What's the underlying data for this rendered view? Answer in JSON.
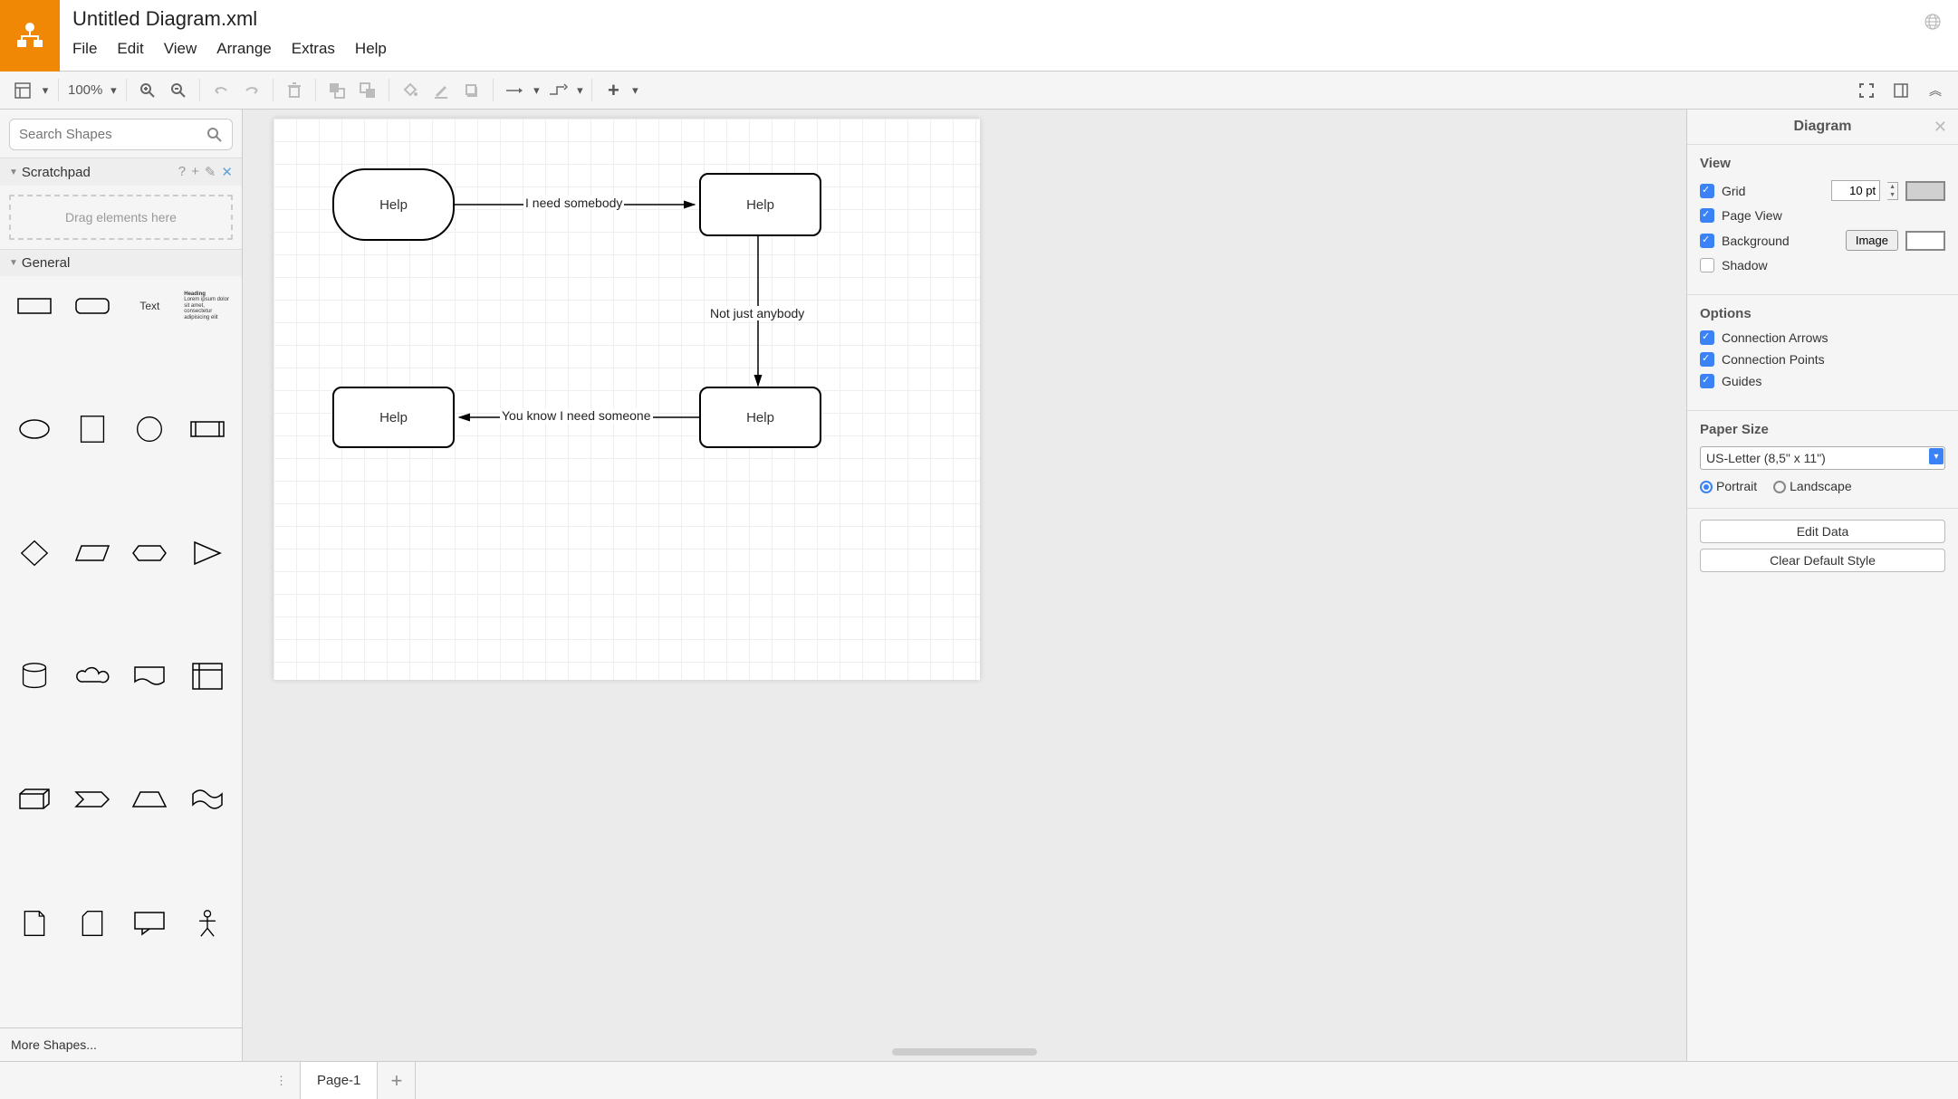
{
  "title": "Untitled Diagram.xml",
  "menu": {
    "file": "File",
    "edit": "Edit",
    "view": "View",
    "arrange": "Arrange",
    "extras": "Extras",
    "help": "Help"
  },
  "toolbar": {
    "zoom": "100%"
  },
  "sidebar": {
    "search_placeholder": "Search Shapes",
    "scratchpad": "Scratchpad",
    "scratchpad_hint": "Drag elements here",
    "general": "General",
    "more_shapes": "More Shapes...",
    "text_shape": "Text",
    "heading_shape_title": "Heading",
    "heading_shape_body": "Lorem ipsum dolor sit amet, consectetur adipisicing elit"
  },
  "canvas": {
    "nodes": {
      "n1": "Help",
      "n2": "Help",
      "n3": "Help",
      "n4": "Help"
    },
    "edges": {
      "e1": "I need somebody",
      "e2": "Not just anybody",
      "e3": "You know I need someone"
    }
  },
  "rpanel": {
    "title": "Diagram",
    "view": "View",
    "grid": "Grid",
    "grid_value": "10 pt",
    "pageview": "Page View",
    "background": "Background",
    "image_btn": "Image",
    "shadow": "Shadow",
    "options": "Options",
    "conn_arrows": "Connection Arrows",
    "conn_points": "Connection Points",
    "guides": "Guides",
    "paper_size": "Paper Size",
    "paper_value": "US-Letter (8,5\" x 11\")",
    "portrait": "Portrait",
    "landscape": "Landscape",
    "edit_data": "Edit Data",
    "clear_style": "Clear Default Style"
  },
  "tabs": {
    "page1": "Page-1"
  }
}
